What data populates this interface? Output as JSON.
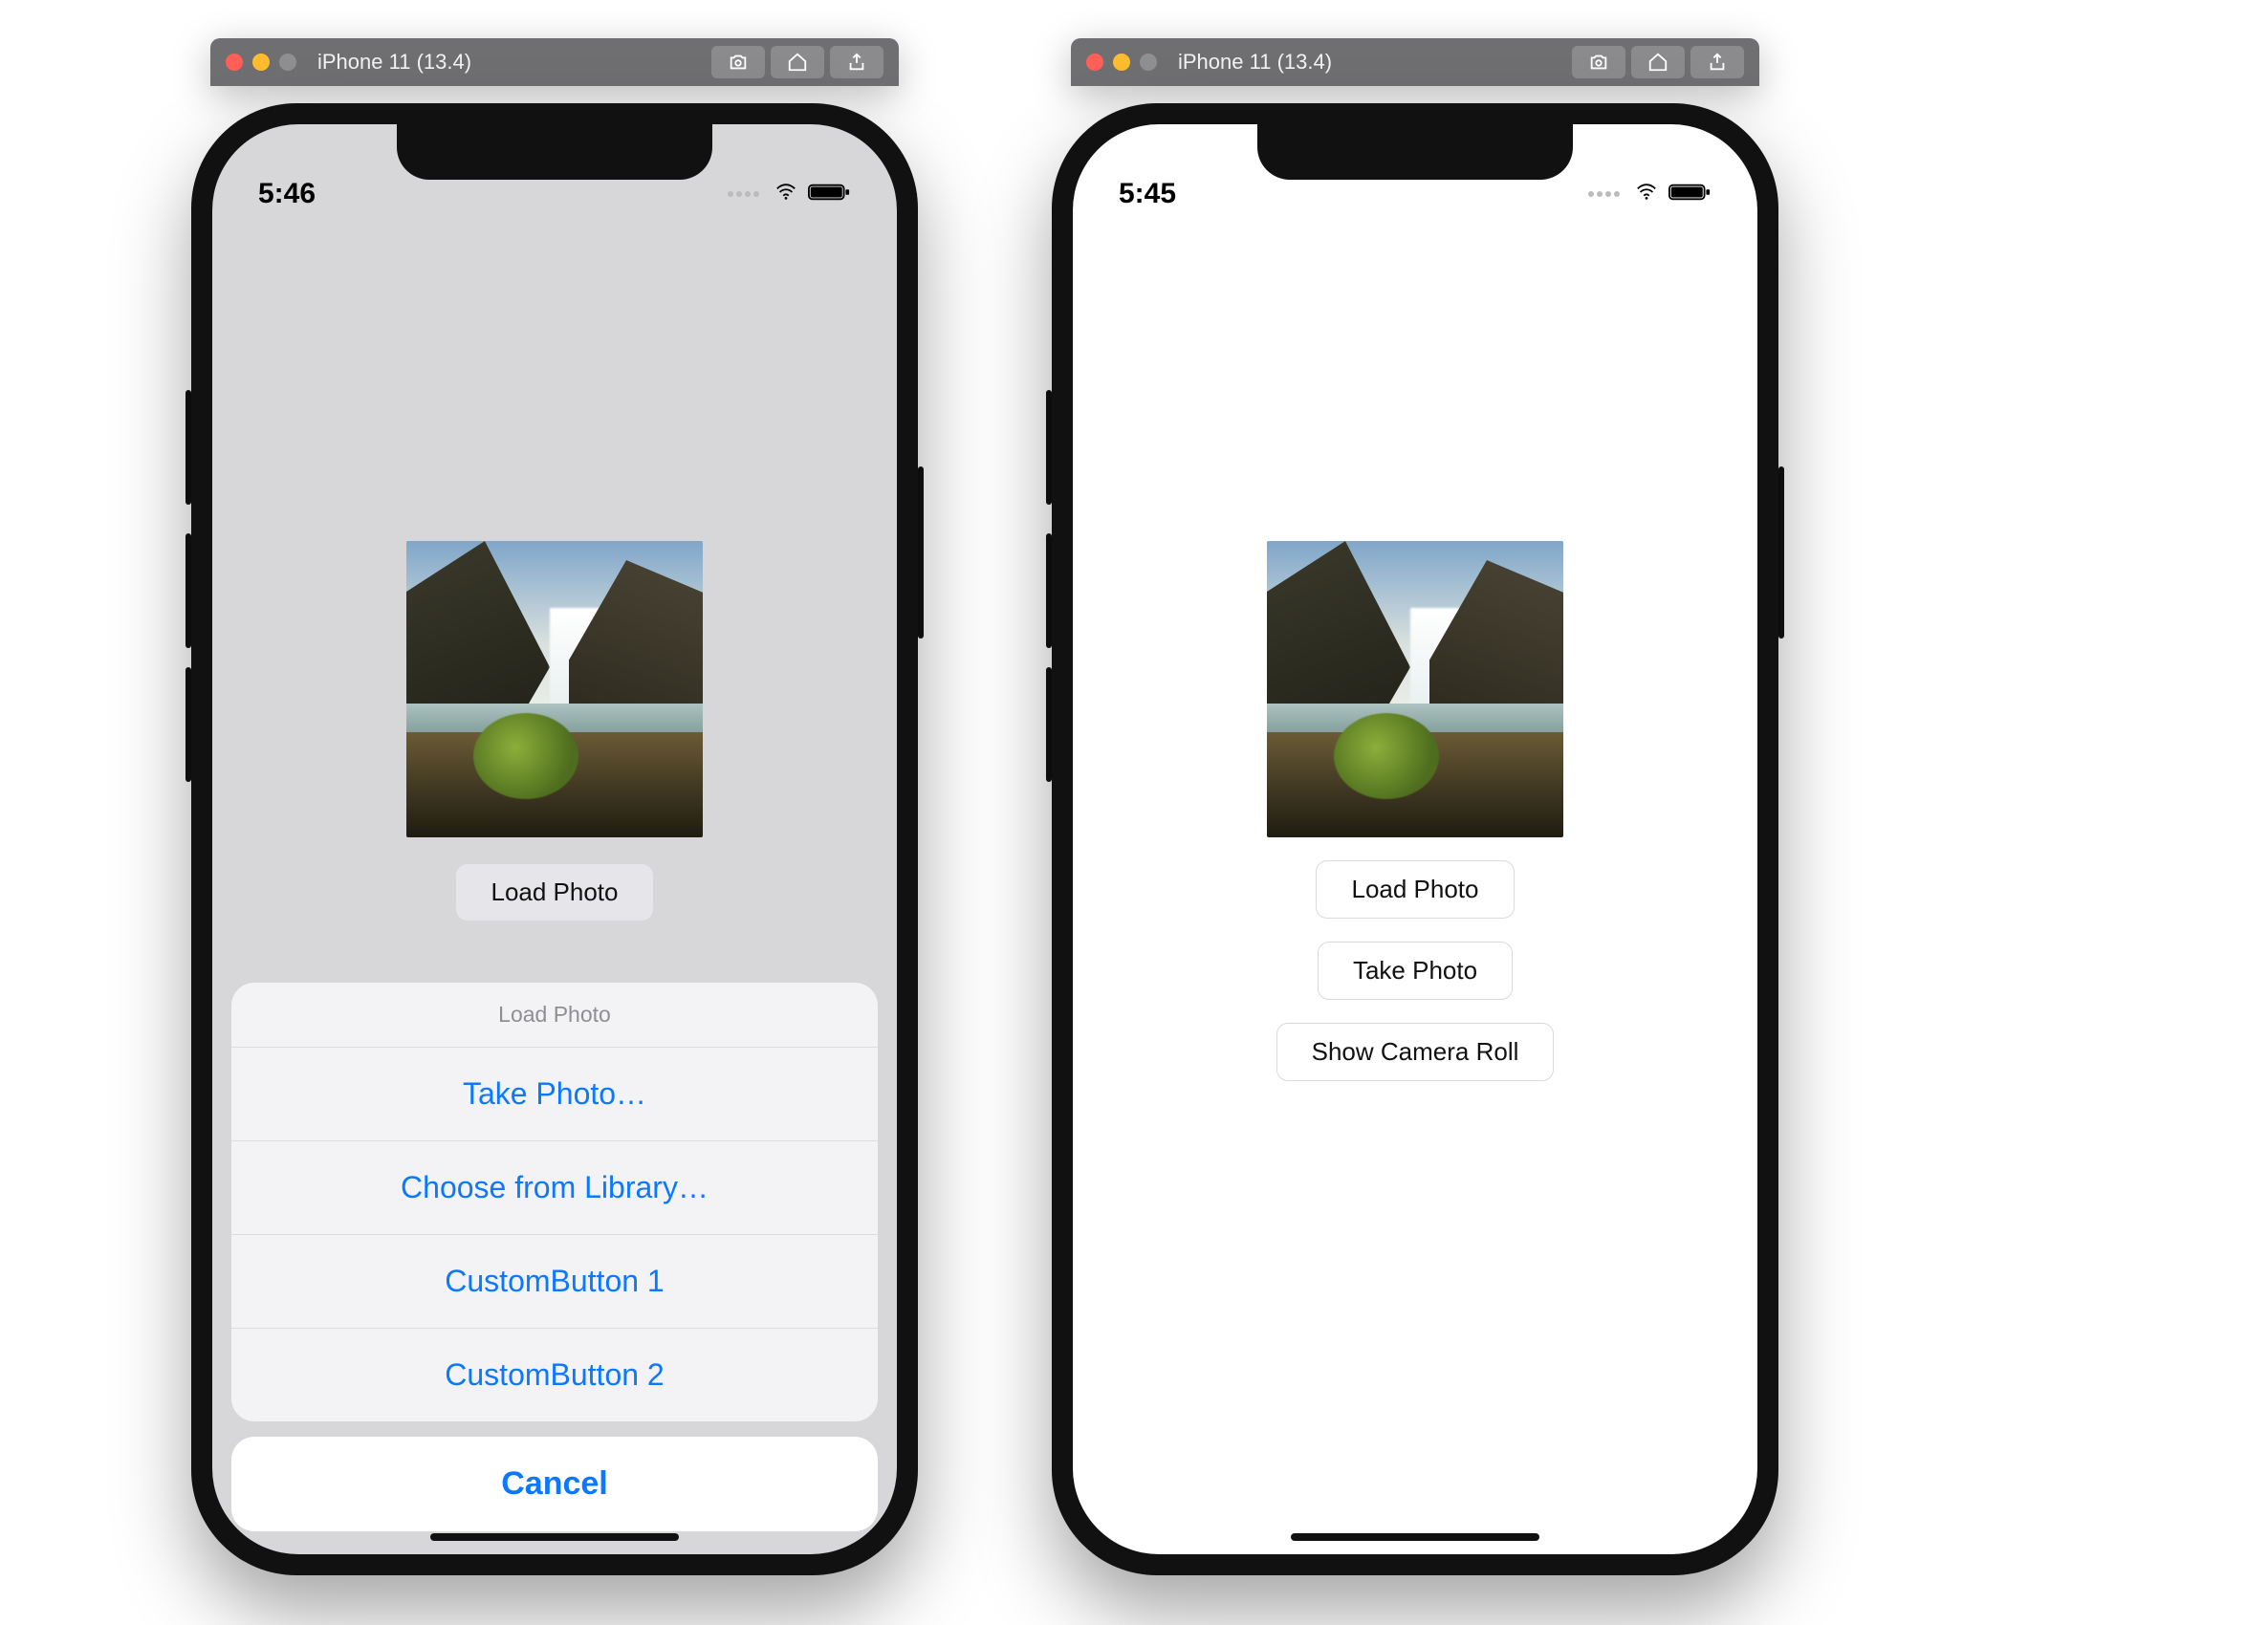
{
  "simulators": {
    "left": {
      "title": "iPhone 11 (13.4)",
      "status_time": "5:46",
      "load_button": "Load Photo",
      "sheet": {
        "title": "Load Photo",
        "items": [
          "Take Photo…",
          "Choose from Library…",
          "CustomButton 1",
          "CustomButton 2"
        ],
        "cancel": "Cancel"
      }
    },
    "right": {
      "title": "iPhone 11 (13.4)",
      "status_time": "5:45",
      "buttons": [
        "Load Photo",
        "Take Photo",
        "Show Camera Roll"
      ]
    }
  },
  "titlebar_icons": [
    "screenshot-icon",
    "home-icon",
    "share-icon"
  ]
}
